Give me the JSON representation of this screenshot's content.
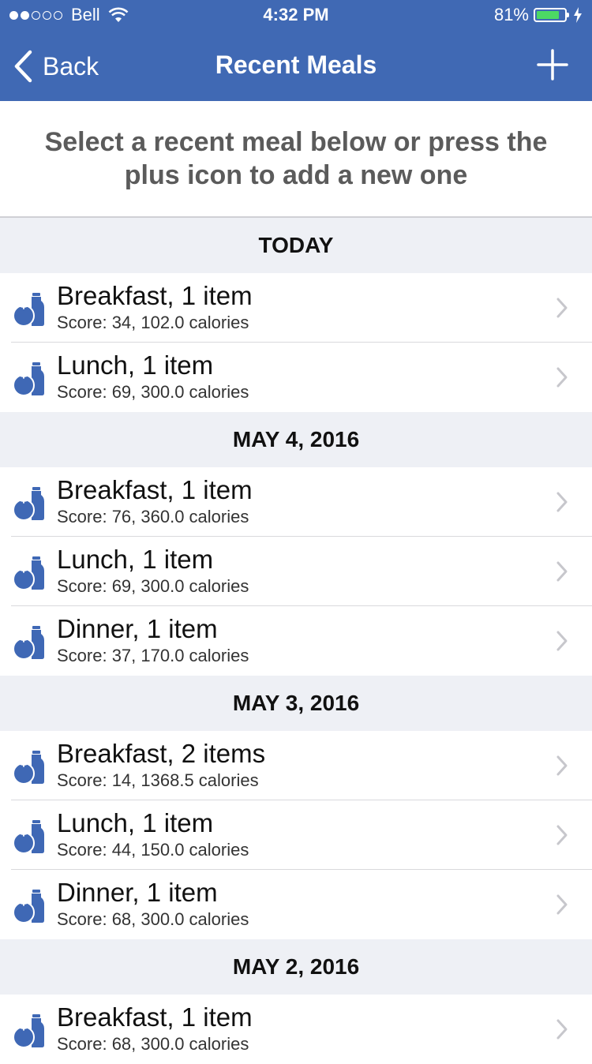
{
  "status_bar": {
    "carrier": "Bell",
    "time": "4:32 PM",
    "battery_percent": "81%",
    "battery_level": 0.81
  },
  "nav": {
    "back_label": "Back",
    "title": "Recent Meals",
    "add_icon": "plus-icon"
  },
  "instructions": "Select a recent meal below or press the plus icon to add a new one",
  "sections": [
    {
      "header": "TODAY",
      "meals": [
        {
          "title": "Breakfast, 1 item",
          "subtitle": "Score: 34, 102.0 calories"
        },
        {
          "title": "Lunch, 1 item",
          "subtitle": "Score: 69, 300.0 calories"
        }
      ]
    },
    {
      "header": "MAY 4, 2016",
      "meals": [
        {
          "title": "Breakfast, 1 item",
          "subtitle": "Score: 76, 360.0 calories"
        },
        {
          "title": "Lunch, 1 item",
          "subtitle": "Score: 69, 300.0 calories"
        },
        {
          "title": "Dinner, 1 item",
          "subtitle": "Score: 37, 170.0 calories"
        }
      ]
    },
    {
      "header": "MAY 3, 2016",
      "meals": [
        {
          "title": "Breakfast, 2 items",
          "subtitle": "Score: 14, 1368.5 calories"
        },
        {
          "title": "Lunch, 1 item",
          "subtitle": "Score: 44, 150.0 calories"
        },
        {
          "title": "Dinner, 1 item",
          "subtitle": "Score: 68, 300.0 calories"
        }
      ]
    },
    {
      "header": "MAY 2, 2016",
      "meals": [
        {
          "title": "Breakfast, 1 item",
          "subtitle": "Score: 68, 300.0 calories"
        }
      ]
    }
  ],
  "colors": {
    "nav_blue": "#4069b4",
    "icon_blue": "#3f68b5",
    "section_bg": "#eef0f5",
    "battery_green": "#4cd964"
  }
}
